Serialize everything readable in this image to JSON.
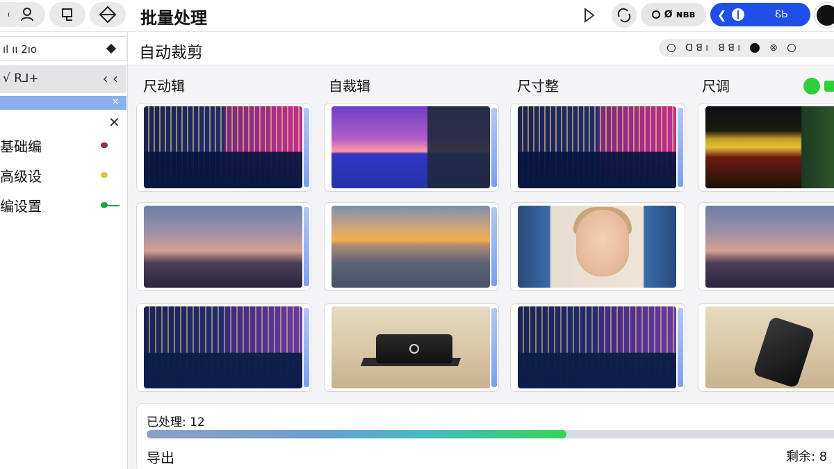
{
  "topbar": {
    "title": "批量处理",
    "pill_label": "Ø ɴʙʙ",
    "blue_label": "ᏋЬ"
  },
  "sidebar": {
    "search_text": "ıl ıı 2ıo",
    "header_text": "√ ꓣ⅃+",
    "header_arrows": "‹ ‹",
    "items": [
      {
        "label": "基础编",
        "color": "#9b2b4a"
      },
      {
        "label": "高级设",
        "color": "#d7c24a"
      },
      {
        "label": "编设置",
        "color": "#18a34a"
      }
    ]
  },
  "main": {
    "subtitle": "自动裁剪",
    "tools": [
      "ꓷ ꓭ ı",
      "ꓭ ꓭ ı"
    ],
    "columns": [
      "尺动辑",
      "自裁辑",
      "尺寸整",
      "尺调"
    ]
  },
  "progress": {
    "processed_label": "已处理: 12",
    "export_label": "导出",
    "remaining_label": "剩余: 8",
    "fraction": 0.6
  },
  "colors": {
    "accent": "#1e4fe6",
    "green": "#2fcf3c",
    "sidebar_highlight": "#8ab0f1"
  }
}
